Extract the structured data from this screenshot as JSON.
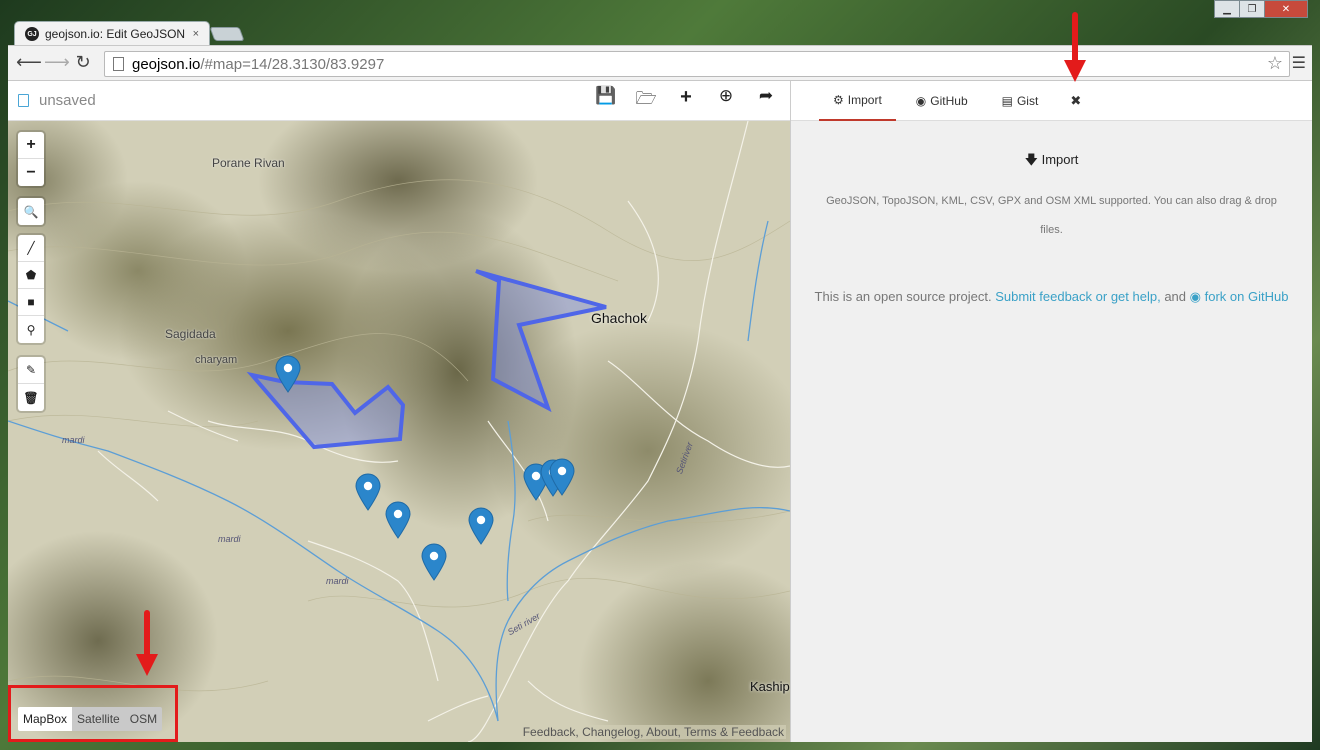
{
  "browser": {
    "tab_title": "geojson.io: Edit GeoJSON",
    "tab_favicon": "GJ",
    "tab_close": "×",
    "url_host": "geojson.io",
    "url_path": "/#map=14/28.3130/83.9297",
    "back_icon": "arrow-left-icon",
    "forward_icon": "arrow-right-icon",
    "reload_icon": "reload-icon",
    "window_controls": [
      "▁",
      "❐",
      "✕"
    ]
  },
  "header": {
    "filename": "unsaved",
    "actions": [
      "save-icon",
      "open-icon",
      "add-icon",
      "download-icon",
      "share-icon"
    ]
  },
  "map": {
    "places": [
      {
        "name": "Porane Rivan"
      },
      {
        "name": "Sagidada"
      },
      {
        "name": "charyam"
      },
      {
        "name": "Ghachok"
      },
      {
        "name": "Kaship"
      }
    ],
    "rivers": [
      "mardi",
      "mardi",
      "mardi",
      "Seti river",
      "Setiriver"
    ],
    "zoom_in": "+",
    "zoom_out": "−",
    "layers": [
      "MapBox",
      "Satellite",
      "OSM"
    ],
    "active_layer": "MapBox",
    "footer": "Feedback, Changelog, About, Terms & Feedback",
    "polygon_color": "#5069e0",
    "marker_color": "#2b86cb"
  },
  "panel": {
    "tabs": [
      {
        "icon": "⚙",
        "label": "Import"
      },
      {
        "icon": "◉",
        "label": "GitHub"
      },
      {
        "icon": "▤",
        "label": "Gist"
      }
    ],
    "close": "✖",
    "import_title": "Import",
    "import_desc": "GeoJSON, TopoJSON, KML, CSV, GPX and OSM XML supported. You can also drag & drop files.",
    "oss_prefix": "This is an open source project.",
    "oss_link1": "Submit feedback or get help,",
    "oss_mid": "and",
    "oss_link2": "fork on GitHub"
  },
  "annotations": {
    "arrow_color": "#e31b1b"
  }
}
